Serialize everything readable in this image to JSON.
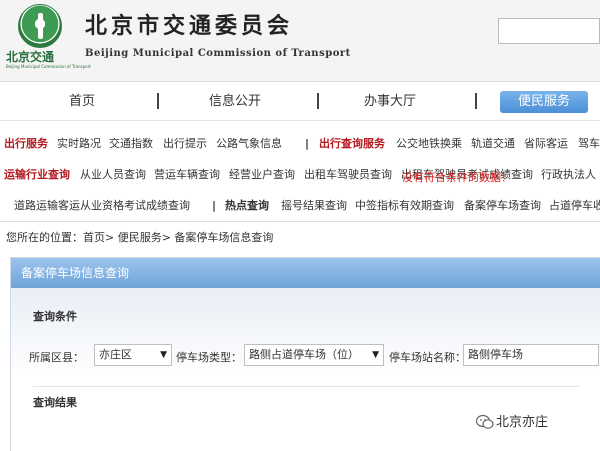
{
  "header": {
    "logo_text": "北京交通",
    "logo_sub": "Beijing Municipal Commission of Transport",
    "title": "北京市交通委员会",
    "title_en": "Beijing Municipal Commission of Transport"
  },
  "nav": {
    "items": [
      "首页",
      "信息公开",
      "办事大厅",
      "便民服务"
    ],
    "active": "便民服务",
    "active_color": "#5b9ade"
  },
  "link_rows": {
    "row1": {
      "h1": "出行服务",
      "links1": [
        "实时路况",
        "交通指数",
        "出行提示",
        "公路气象信息"
      ],
      "h2": "出行查询服务",
      "links2": [
        "公交地铁换乘",
        "轨道交通",
        "省际客运",
        "驾车"
      ]
    },
    "row2": {
      "h1": "运输行业查询",
      "links1": [
        "从业人员查询",
        "营运车辆查询",
        "经营业户查询",
        "出租车驾驶员查询",
        "出租车驾驶员考试成绩查询",
        "行政执法人"
      ]
    },
    "row3": {
      "links0": [
        "道路运输客运从业资格考试成绩查询"
      ],
      "h1": "热点查询",
      "links1": [
        "摇号结果查询",
        "中签指标有效期查询",
        "备案停车场查询",
        "占道停车收"
      ]
    },
    "heading_color": "#b3191e"
  },
  "breadcrumb": "您所在的位置：首页> 便民服务> 备案停车场信息查询",
  "panel": {
    "title": "备案停车场信息查询",
    "conditions_title": "查询条件",
    "district_label": "所属区县：",
    "district_value": "亦庄区",
    "type_label": "停车场类型：",
    "type_value": "路侧占道停车场（位）",
    "name_label": "停车场站名称：",
    "name_value": "路侧停车场",
    "results_title": "查询结果",
    "empty_message": "没有符合条件的数据！"
  },
  "watermark": {
    "text": "北京亦庄"
  }
}
